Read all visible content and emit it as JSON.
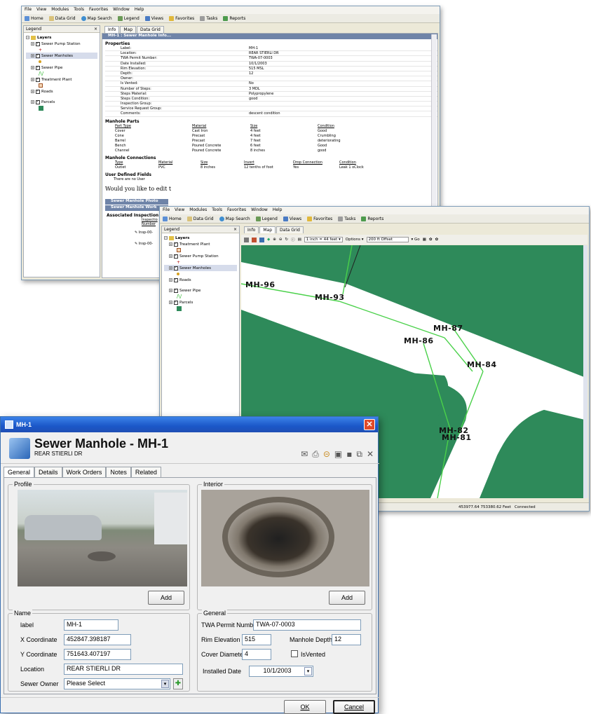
{
  "w1": {
    "menu": [
      "File",
      "View",
      "Modules",
      "Tools",
      "Favorites",
      "Window",
      "Help"
    ],
    "toolbar": [
      "Home",
      "Data Grid",
      "Map Search",
      "Legend",
      "Views",
      "Favorites",
      "Tasks",
      "Reports"
    ],
    "legend_title": "Legend",
    "close_glyph": "×",
    "layers_label": "Layers",
    "layers": [
      "Sewer Pump Station",
      "Sewer Manholes",
      "Sewer Pipe",
      "Treatment Plant",
      "Roads",
      "Parcels"
    ],
    "tabs": [
      "Info",
      "Map",
      "Data Grid"
    ],
    "banner": "MH-1 : Sewer Manhole Info...",
    "properties_title": "Properties",
    "properties": [
      {
        "k": "Label:",
        "v": "MH-1"
      },
      {
        "k": "Location:",
        "v": "REAR STIERLI DR"
      },
      {
        "k": "TWA Permit Number:",
        "v": "TWA-07-0003"
      },
      {
        "k": "Date Installed:",
        "v": "10/1/2003"
      },
      {
        "k": "Rim Elevation:",
        "v": "515 MSL"
      },
      {
        "k": "Depth:",
        "v": "12"
      },
      {
        "k": "Owner:",
        "v": ""
      },
      {
        "k": "Is Vented:",
        "v": "No"
      },
      {
        "k": "Number of Steps:",
        "v": "3 MDL"
      },
      {
        "k": "Steps Material:",
        "v": "Polypropylene"
      },
      {
        "k": "Steps Condition:",
        "v": "good"
      },
      {
        "k": "Inspection Group:",
        "v": ""
      },
      {
        "k": "Service Request Group:",
        "v": ""
      },
      {
        "k": "Comments:",
        "v": "descent condition"
      }
    ],
    "parts_title": "Manhole Parts",
    "parts_headers": [
      "Part Type",
      "Material",
      "Size",
      "Condition"
    ],
    "parts": [
      [
        "Cover",
        "Cast Iron",
        "4 feet",
        "Good"
      ],
      [
        "Cone",
        "Precast",
        "4 feet",
        "Crumbling"
      ],
      [
        "Barrel",
        "Precast",
        "7 feet",
        "deteriorating"
      ],
      [
        "Bench",
        "Poured Concrete",
        "6 feet",
        "Good"
      ],
      [
        "Channel",
        "Poured Concrete",
        "8 inches",
        "good"
      ]
    ],
    "conn_title": "Manhole Connections",
    "conn_headers": [
      "Type",
      "Material",
      "Size",
      "Invert",
      "Drop Connection",
      "Condition"
    ],
    "conn": [
      [
        "Outlet",
        "PVC",
        "8 inches",
        "12 tenths of foot",
        "Yes",
        "Leak 1 oClock"
      ]
    ],
    "udf_title": "User Defined Fields",
    "udf_text": "There are no User",
    "ask_text": "Would you like to edit t",
    "photos_bar": "Sewer Manhole Photo",
    "work_bar": "Sewer Manhole Work",
    "assoc_title": "Associated Inspection",
    "assoc_cols": [
      "Inspectio",
      "Number"
    ],
    "assoc_items": [
      "Insp-00-",
      "Insp-00-"
    ]
  },
  "w2": {
    "menu": [
      "File",
      "View",
      "Modules",
      "Tools",
      "Favorites",
      "Window",
      "Help"
    ],
    "toolbar": [
      "Home",
      "Data Grid",
      "Map Search",
      "Legend",
      "Views",
      "Favorites",
      "Tasks",
      "Reports"
    ],
    "legend_title": "Legend",
    "close_glyph": "×",
    "layers_label": "Layers",
    "layers": [
      "Treatment Plant",
      "Sewer Pump Station",
      "Sewer Manholes",
      "Roads",
      "Sewer Pipe",
      "Parcels"
    ],
    "tabs": [
      "Info",
      "Map",
      "Data Grid"
    ],
    "scale": "1 inch = 44 feet",
    "options": "Options",
    "offset": "200 ft Offset",
    "go": "Go",
    "manholes": [
      "MH-96",
      "MH-93",
      "MH-87",
      "MH-86",
      "MH-84",
      "MH-82",
      "MH-81"
    ],
    "coords": "453977.64 753380.62 Feet",
    "conn_status": "Connected"
  },
  "dlg": {
    "title": "MH-1",
    "close": "✕",
    "heading": "Sewer Manhole - MH-1",
    "subtitle": "REAR STIERLI DR",
    "tabs": [
      "General",
      "Details",
      "Work Orders",
      "Notes",
      "Related"
    ],
    "profile_label": "Profile",
    "interior_label": "Interior",
    "add_label": "Add",
    "name_group": "Name",
    "label_lbl": "label",
    "label_val": "MH-1",
    "x_lbl": "X Coordinate",
    "x_val": "452847.398187",
    "y_lbl": "Y Coordinate",
    "y_val": "751643.407197",
    "loc_lbl": "Location",
    "loc_val": "REAR STIERLI DR",
    "owner_lbl": "Sewer Owner",
    "owner_val": "Please Select",
    "general_group": "General",
    "twa_lbl": "TWA Permit Number",
    "twa_val": "TWA-07-0003",
    "rim_lbl": "Rim Elevation",
    "rim_val": "515",
    "depth_lbl": "Manhole Depth",
    "depth_val": "12",
    "cover_lbl": "Cover Diameter",
    "cover_val": "4",
    "vented_lbl": "IsVented",
    "installed_lbl": "Installed Date",
    "installed_val": "10/1/2003",
    "ok": "OK",
    "cancel": "Cancel"
  }
}
